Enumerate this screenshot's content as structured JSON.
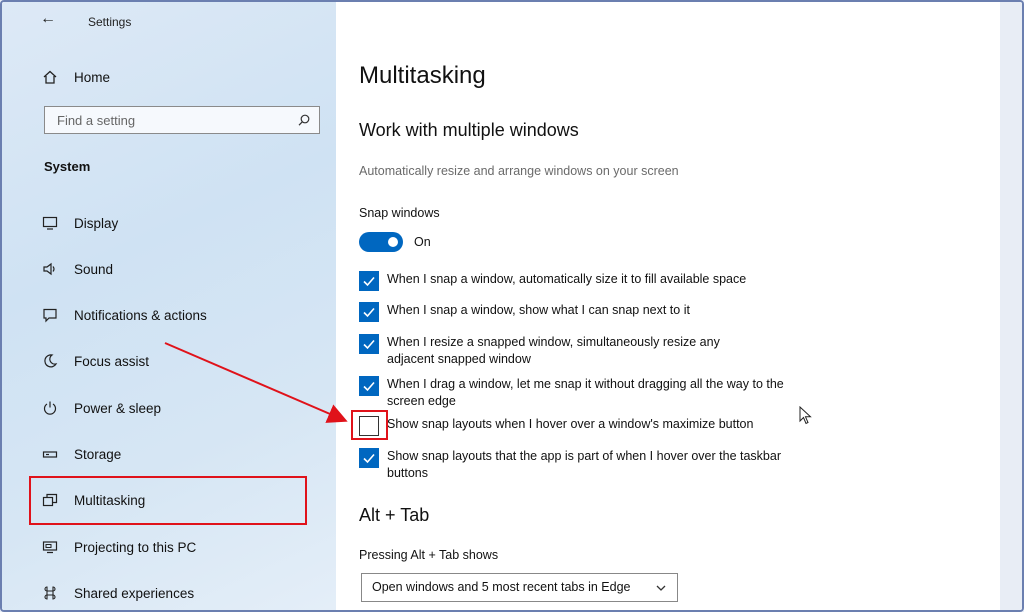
{
  "window": {
    "title": "Settings",
    "back_icon": "arrow-left-icon"
  },
  "sidebar": {
    "home_label": "Home",
    "search_placeholder": "Find a setting",
    "section_label": "System",
    "items": [
      {
        "label": "Display",
        "icon": "monitor-icon"
      },
      {
        "label": "Sound",
        "icon": "speaker-icon"
      },
      {
        "label": "Notifications & actions",
        "icon": "message-icon"
      },
      {
        "label": "Focus assist",
        "icon": "moon-icon"
      },
      {
        "label": "Power & sleep",
        "icon": "power-icon"
      },
      {
        "label": "Storage",
        "icon": "storage-icon"
      },
      {
        "label": "Multitasking",
        "icon": "windows-stack-icon"
      },
      {
        "label": "Projecting to this PC",
        "icon": "projector-icon"
      },
      {
        "label": "Shared experiences",
        "icon": "share-icon"
      }
    ]
  },
  "main": {
    "page_title": "Multitasking",
    "section_title": "Work with multiple windows",
    "section_desc": "Automatically resize and arrange windows on your screen",
    "snap_label": "Snap windows",
    "snap_state": "On",
    "options": [
      {
        "label": "When I snap a window, automatically size it to fill available space",
        "checked": true
      },
      {
        "label": "When I snap a window, show what I can snap next to it",
        "checked": true
      },
      {
        "label": "When I resize a snapped window, simultaneously resize any adjacent snapped window",
        "checked": true
      },
      {
        "label": "When I drag a window, let me snap it without dragging all the way to the screen edge",
        "checked": true
      },
      {
        "label": "Show snap layouts when I hover over a window's maximize button",
        "checked": false
      },
      {
        "label": "Show snap layouts that the app is part of when I hover over the taskbar buttons",
        "checked": true
      }
    ],
    "alt_tab_title": "Alt + Tab",
    "alt_tab_label": "Pressing Alt + Tab shows",
    "alt_tab_value": "Open windows and 5 most recent tabs in Edge"
  },
  "colors": {
    "accent": "#0067c0",
    "annotation": "#e0121a"
  }
}
